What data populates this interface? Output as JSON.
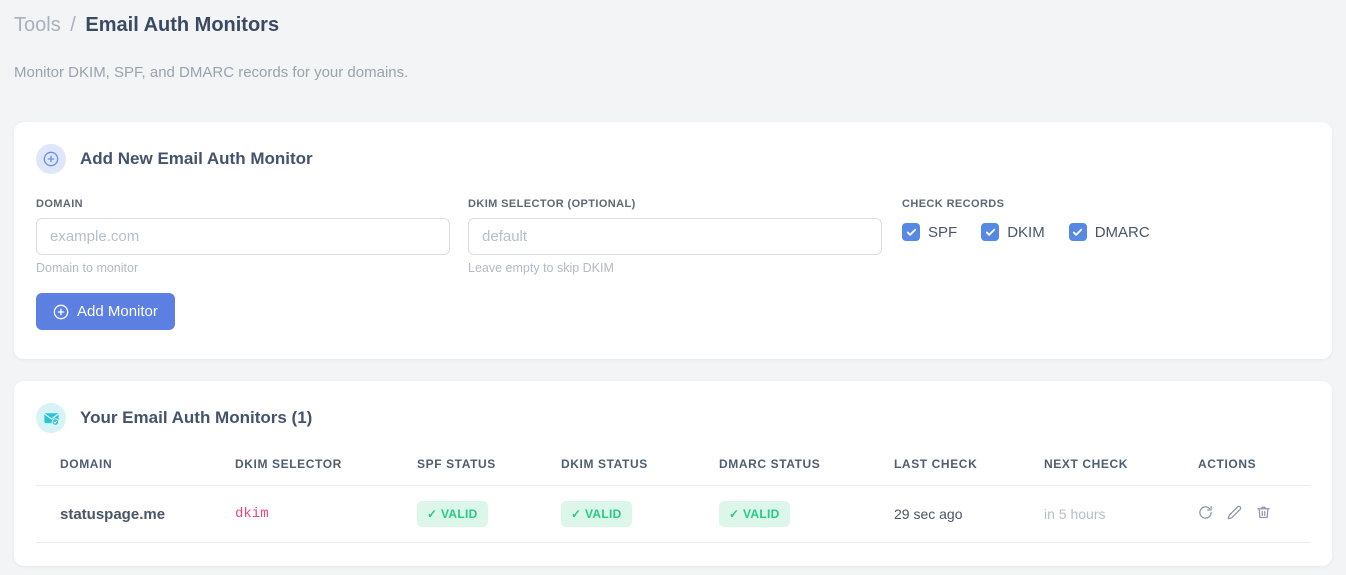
{
  "breadcrumb": {
    "section": "Tools",
    "separator": "/",
    "current": "Email Auth Monitors"
  },
  "subtitle": "Monitor DKIM, SPF, and DMARC records for your domains.",
  "add_card": {
    "icon": "plus-circle-icon",
    "title": "Add New Email Auth Monitor",
    "fields": {
      "domain": {
        "label": "DOMAIN",
        "value": "",
        "placeholder": "example.com",
        "hint": "Domain to monitor"
      },
      "dkim_selector": {
        "label": "DKIM SELECTOR (OPTIONAL)",
        "value": "",
        "placeholder": "default",
        "hint": "Leave empty to skip DKIM"
      }
    },
    "check_records": {
      "label": "CHECK RECORDS",
      "options": [
        {
          "label": "SPF",
          "checked": true
        },
        {
          "label": "DKIM",
          "checked": true
        },
        {
          "label": "DMARC",
          "checked": true
        }
      ]
    },
    "submit": {
      "icon": "plus-circle-icon",
      "label": "Add Monitor"
    }
  },
  "monitors_card": {
    "icon": "envelope-check-icon",
    "title": "Your Email Auth Monitors (1)",
    "count": 1,
    "table": {
      "headers": [
        "DOMAIN",
        "DKIM SELECTOR",
        "SPF STATUS",
        "DKIM STATUS",
        "DMARC STATUS",
        "LAST CHECK",
        "NEXT CHECK",
        "ACTIONS"
      ],
      "rows": [
        {
          "domain": "statuspage.me",
          "dkim_selector": "dkim",
          "spf_status": "✓ VALID",
          "dkim_status": "✓ VALID",
          "dmarc_status": "✓ VALID",
          "last_check": "29 sec ago",
          "next_check": "in 5 hours",
          "actions": [
            "refresh-icon",
            "edit-icon",
            "delete-icon"
          ]
        }
      ]
    }
  },
  "colors": {
    "accent_blue": "#5b80e1",
    "checkbox_blue": "#5589e4",
    "badge_green_bg": "#dcf7ea",
    "badge_green_text": "#29c985",
    "code_pink": "#e8488b",
    "icon_teal": "#29c5d2",
    "page_background": "#f3f4f5"
  }
}
